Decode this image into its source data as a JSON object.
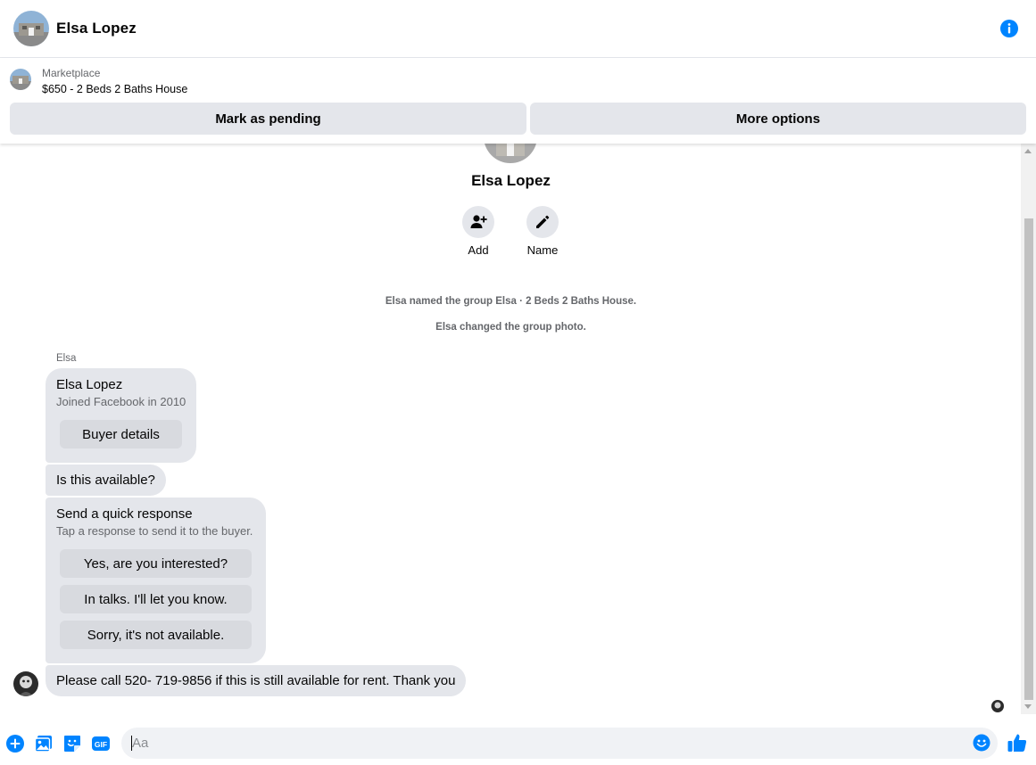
{
  "header": {
    "name": "Elsa Lopez"
  },
  "listing": {
    "label": "Marketplace",
    "title": "$650 - 2 Beds 2 Baths House",
    "primary_action": "Mark as pending",
    "secondary_action": "More options"
  },
  "profile": {
    "name": "Elsa Lopez",
    "actions": [
      {
        "label": "Add"
      },
      {
        "label": "Name"
      }
    ]
  },
  "system_messages": [
    "Elsa named the group Elsa · 2 Beds 2 Baths House.",
    "Elsa changed the group photo."
  ],
  "messages": {
    "sender_label": "Elsa",
    "profile_card": {
      "name": "Elsa Lopez",
      "subtitle": "Joined Facebook in 2010",
      "button": "Buyer details"
    },
    "availability": "Is this available?",
    "quick_response": {
      "title": "Send a quick response",
      "subtitle": "Tap a response to send it to the buyer.",
      "options": [
        "Yes, are you interested?",
        "In talks. I'll let you know.",
        "Sorry, it's not available."
      ]
    },
    "last_message": "Please call 520- 719-9856 if this is still available for rent. Thank you"
  },
  "composer": {
    "placeholder": "Aa"
  },
  "icons": {
    "info": "info-icon",
    "add_person": "add-person-icon",
    "pencil": "pencil-icon",
    "plus": "plus-circle-icon",
    "photo": "photo-icon",
    "sticker": "sticker-icon",
    "gif": "gif-icon",
    "emoji": "emoji-icon",
    "like": "thumbs-up-icon"
  },
  "colors": {
    "accent": "#0084ff",
    "bubble": "#e4e6eb",
    "secondary_text": "#65676b"
  }
}
